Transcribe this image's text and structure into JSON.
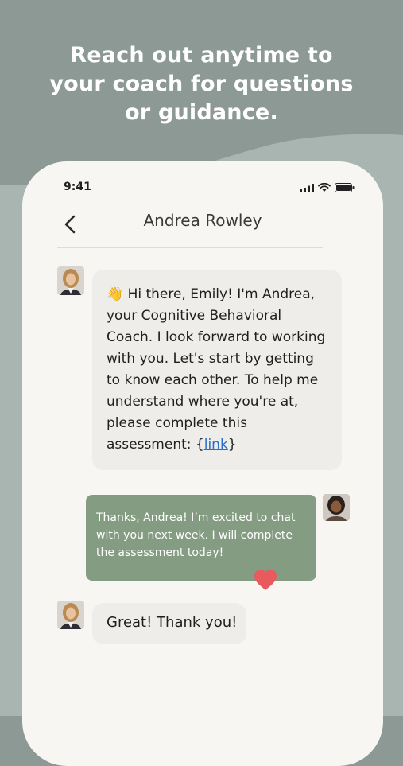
{
  "headline": {
    "lines": [
      "Reach out anytime to",
      "your coach for questions",
      "or guidance."
    ]
  },
  "status_bar": {
    "time": "9:41"
  },
  "chat": {
    "title": "Andrea Rowley",
    "messages": [
      {
        "sender": "coach",
        "emoji": "👋",
        "text": "Hi there, Emily! I'm Andrea, your Cognitive Behavioral Coach. I look forward to working with you. Let's start by getting to know each other. To help me understand where you're at, please complete this assessment: {",
        "link_text": "link",
        "text_after_link": "}"
      },
      {
        "sender": "user",
        "text": "Thanks, Andrea! I’m excited to chat with you next week. I will complete the assessment today!",
        "reaction": "heart-icon"
      },
      {
        "sender": "coach",
        "text": "Great! Thank you!"
      }
    ]
  },
  "colors": {
    "background_top": "#8c9994",
    "background_wave": "#a8b5b1",
    "phone": "#f7f6f3",
    "coach_bubble": "#efedea",
    "user_bubble": "#849c81",
    "heart": "#e85a5e",
    "link": "#2a6fc9"
  }
}
